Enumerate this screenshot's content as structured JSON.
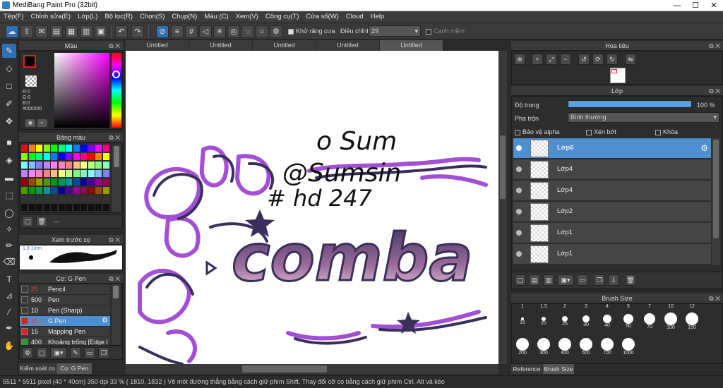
{
  "app": {
    "title": "MediBang Paint Pro (32bit)",
    "min": "—",
    "max": "☐",
    "close": "✕"
  },
  "menu": [
    "Tệp(F)",
    "Chỉnh sửa(E)",
    "Lớp(L)",
    "Bộ lọc(R)",
    "Chọn(S)",
    "Chụp(N)",
    "Màu (C)",
    "Xem(V)",
    "Công cụ(T)",
    "Cửa sổ(W)",
    "Cloud",
    "Help"
  ],
  "toolbar": {
    "antialias": "Khử răng cưa",
    "correction": "Điều chỉnh",
    "correction_value": "29",
    "sharp": "Cạnh mềm"
  },
  "tabs": [
    "Untitled",
    "Untitled",
    "Untitled",
    "Untitled",
    "Untitled"
  ],
  "color_panel": {
    "title": "Màu",
    "r": "R:0",
    "g": "G:0",
    "b": "B:0",
    "hex": "#000000"
  },
  "palette_panel": {
    "title": "Bảng màu",
    "dots": "---"
  },
  "brush_preview": {
    "title": "Xem trước cọ",
    "size": "1.8 1mm"
  },
  "brush_panel": {
    "title": "Cọ: G Pen",
    "items": [
      {
        "size": "25",
        "name": "Pencil",
        "color": "#3a3a3a"
      },
      {
        "size": "500",
        "name": "Pen",
        "color": "#3a3a3a"
      },
      {
        "size": "10",
        "name": "Pen (Sharp)",
        "color": "#3a3a3a"
      },
      {
        "size": "25",
        "name": "G Pen",
        "color": "#e02020"
      },
      {
        "size": "15",
        "name": "Mapping Pen",
        "color": "#e02020"
      },
      {
        "size": "400",
        "name": "Khoảng trống [Edge l",
        "color": "#2a9a2a"
      }
    ]
  },
  "bottom_tabs": [
    "Kiểm soát co",
    "Cọ: G Pen"
  ],
  "navigator": {
    "title": "Hoa tiêu"
  },
  "layer_panel": {
    "title": "Lớp",
    "opacity_label": "Độ trong",
    "opacity": "100 %",
    "blend_label": "Pha trộn",
    "blend_value": "Bình thường",
    "protect_alpha": "Bảo vệ alpha",
    "clipping": "Xén bớt",
    "lock": "Khóa",
    "layers": [
      "Lớp6",
      "Lớp4",
      "Lớp4",
      "Lớp2",
      "Lớp1",
      "Lớp1"
    ]
  },
  "brush_size": {
    "title": "Brush Size",
    "header": [
      "1",
      "1.5",
      "2",
      "3",
      "4",
      "5",
      "7",
      "10",
      "12"
    ],
    "row1": [
      "15",
      "20",
      "25",
      "30",
      "40",
      "50",
      "70",
      "100",
      "150"
    ],
    "row2": [
      "200",
      "300",
      "400",
      "500",
      "700",
      "1000"
    ]
  },
  "right_tabs": [
    "Reference",
    "Brush Size"
  ],
  "canvas_text": {
    "line1": "o Sum",
    "line2": "@Sumsin",
    "line3": "# hd 247",
    "art": "comba"
  },
  "status": "5511 * 5511 pixel  (40 * 40cm)  350 dpi  33 %  ( 1810, 1832 )  Vẽ một đường thẳng bằng cách giữ phím Shift, Thay đổi cỡ cọ bằng cách giữ phím Ctrl, Alt và kéo",
  "colors": {
    "accent": "#4d8fd1",
    "purple": "#a24fd6",
    "dark": "#3a2f5a"
  }
}
